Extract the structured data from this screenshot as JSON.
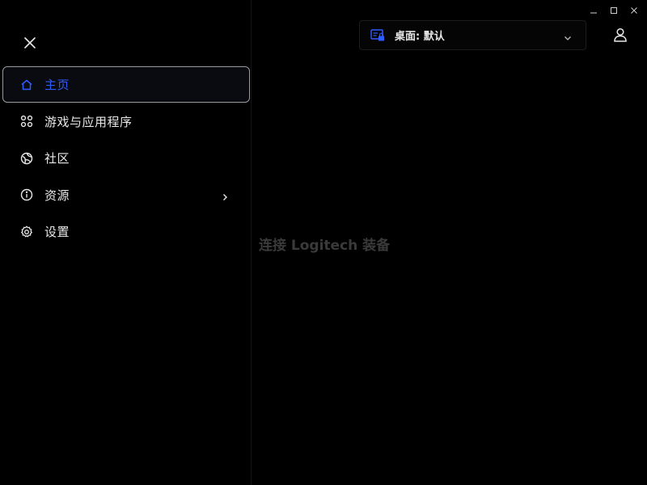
{
  "sidebar": {
    "items": [
      {
        "label": "主页",
        "icon": "home-icon",
        "active": true
      },
      {
        "label": "游戏与应用程序",
        "icon": "apps-icon"
      },
      {
        "label": "社区",
        "icon": "community-icon"
      },
      {
        "label": "资源",
        "icon": "info-icon",
        "has_submenu": true
      },
      {
        "label": "设置",
        "icon": "gear-icon"
      }
    ]
  },
  "header": {
    "profile_label": "桌面: 默认"
  },
  "main": {
    "empty_message": "连接 Logitech 装备"
  },
  "colors": {
    "accent": "#2f5cff",
    "background": "#000000",
    "muted_text": "#3a3a3a"
  }
}
